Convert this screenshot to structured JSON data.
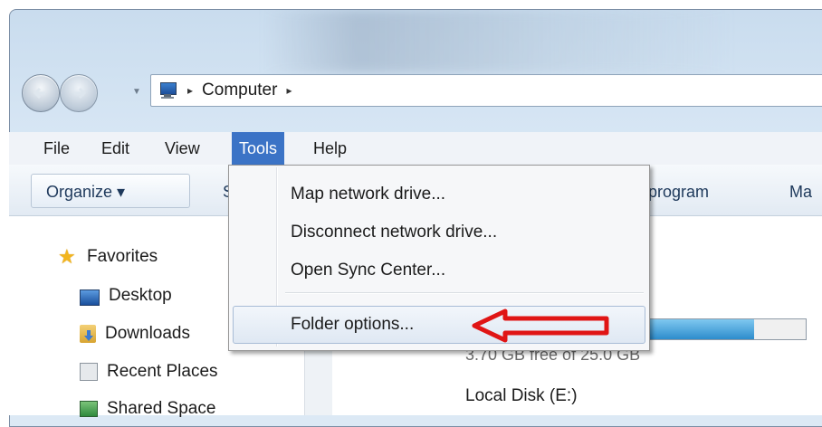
{
  "address_bar": {
    "breadcrumb": "Computer",
    "arrow_left": "▸",
    "arrow_right": "▸"
  },
  "menubar": {
    "items": [
      "File",
      "Edit",
      "View",
      "Tools",
      "Help"
    ],
    "active": "Tools"
  },
  "toolbar": {
    "organize_label": "Organize ▾",
    "partial_1": "S",
    "partial_2": "program",
    "partial_3": "Ma"
  },
  "tools_menu": {
    "items": [
      "Map network drive...",
      "Disconnect network drive...",
      "Open Sync Center...",
      "Folder options..."
    ],
    "highlighted": "Folder options..."
  },
  "nav_pane": {
    "favorites_label": "Favorites",
    "items": [
      "Desktop",
      "Downloads",
      "Recent Places",
      "Shared Space"
    ]
  },
  "content": {
    "drive_free_text": "3.70 GB free of 25.0 GB",
    "drive_used_fraction": 0.85,
    "next_drive_label": "Local Disk (E:)"
  },
  "annotation": {
    "arrow_color": "#e01515"
  }
}
